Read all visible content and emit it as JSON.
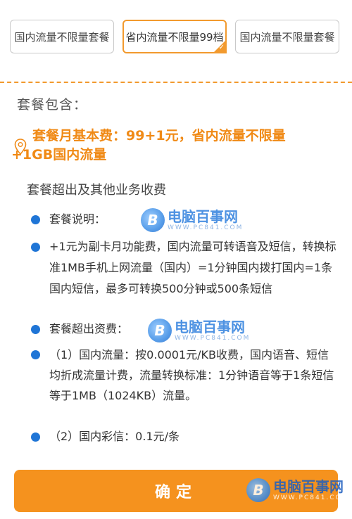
{
  "tabs": [
    {
      "label": "国内流量不限量套餐",
      "selected": false
    },
    {
      "label": "省内流量不限量99档",
      "selected": true
    },
    {
      "label": "国内流量不限量套餐",
      "selected": false
    }
  ],
  "selected_check": "✓",
  "package": {
    "includes_label": "套餐包含：",
    "basic_fee_line1": "套餐月基本费：99+1元，省内流量不限量",
    "basic_fee_line2": "+1GB国内流量",
    "other_fees_label": "套餐超出及其他业务收费"
  },
  "items": [
    {
      "text": "套餐说明："
    },
    {
      "text": "+1元为副卡月功能费，国内流量可转语音及短信，转换标准1MB手机上网流量（国内）=1分钟国内拨打国内=1条国内短信，最多可转换500分钟或500条短信"
    },
    {
      "text": "套餐超出资费："
    },
    {
      "text": "（1）国内流量：按0.0001元/KB收费，国内语音、短信均折成流量计费，流量转换标准：1分钟语音等于1条短信等于1MB（1024KB）流量。"
    },
    {
      "text": "（2）国内彩信：0.1元/条"
    }
  ],
  "watermark": {
    "name": "电脑百事网",
    "url": "WWW.PC841.COM",
    "logo_letter": "B"
  },
  "confirm_label": "确定",
  "colors": {
    "accent": "#f5921e",
    "bullet": "#1f75d6",
    "highlight_text": "#f08a16"
  }
}
